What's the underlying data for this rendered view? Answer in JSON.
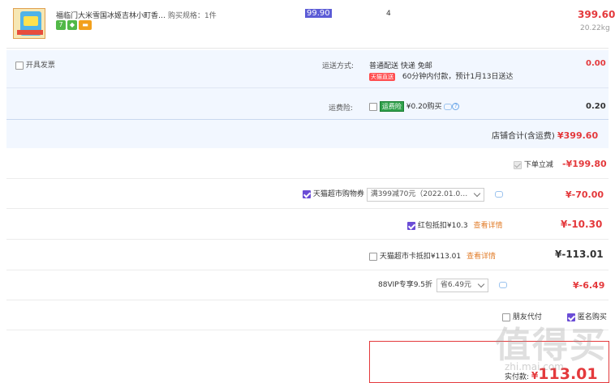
{
  "product": {
    "title": "福临门大米雪国冰姬吉林小町香…",
    "spec": "购买规格：1件",
    "badges": [
      {
        "icon": "seven-day-return-icon",
        "text": "7",
        "color": "#52b848"
      },
      {
        "icon": "shield-icon",
        "text": "◆",
        "color": "#52b848"
      },
      {
        "icon": "card-icon",
        "text": "▬",
        "color": "#f2a01c"
      }
    ],
    "unit_price": "99.90",
    "quantity": "4",
    "total": "399.60",
    "weight": "20.22kg"
  },
  "invoice": {
    "label": "开具发票"
  },
  "shipping": {
    "label": "运送方式:",
    "method": "普通配送 快递 免邮",
    "tmall_tag": "天猫直送",
    "note": "60分钟内付款，预计1月13日送达",
    "price": "0.00"
  },
  "insurance": {
    "label": "运费险:",
    "tag": "运费险",
    "price_text": "¥0.20购买",
    "price": "0.20"
  },
  "shop_total": {
    "label": "店铺合计(含运费)",
    "value": "¥399.60"
  },
  "discounts": {
    "instant": {
      "label": "下单立减",
      "value": "-¥199.80"
    },
    "coupon": {
      "label": "天猫超市购物券",
      "selected": "满399减70元（2022.01.0…",
      "value": "¥-70.00"
    },
    "red_packet": {
      "label": "红包抵扣¥10.3",
      "link": "查看详情",
      "value": "¥-10.30"
    },
    "card": {
      "label": "天猫超市卡抵扣¥113.01",
      "link": "查看详情",
      "value": "¥-113.01"
    },
    "vip": {
      "label": "88VIP专享9.5折",
      "selected": "省6.49元",
      "value": "¥-6.49"
    }
  },
  "options": {
    "friend_pay": "朋友代付",
    "anonymous": "匿名购买"
  },
  "payment": {
    "label": "实付款:",
    "value": "113.01",
    "currency": "¥"
  },
  "watermark": {
    "main": "值得买",
    "sub": "zhi.mai.com"
  }
}
